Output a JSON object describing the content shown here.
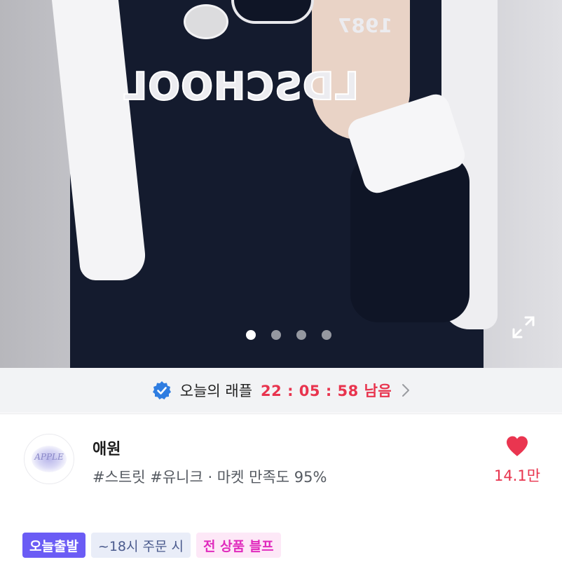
{
  "product_image": {
    "print_text": "LDSCHOOL",
    "print_number": "1987",
    "carousel": {
      "total": 4,
      "active_index": 1
    },
    "expand_icon": "expand-icon"
  },
  "raffle": {
    "icon": "verified-check-icon",
    "title": "오늘의 래플",
    "countdown": "22 : 05 : 58 남음",
    "chevron_icon": "chevron-right-icon",
    "accent_color": "#e8344e"
  },
  "seller": {
    "avatar_text": "APPLE",
    "name": "애원",
    "tags": "#스트릿 #유니크 · 마켓 만족도 95%",
    "like_icon": "heart-icon",
    "likes": "14.1만"
  },
  "badges": [
    {
      "label": "오늘출발",
      "color": "#6b5cf5"
    },
    {
      "label": "~18시 주문 시"
    },
    {
      "label": "전 상품 블프",
      "color": "#e02bbd"
    }
  ]
}
